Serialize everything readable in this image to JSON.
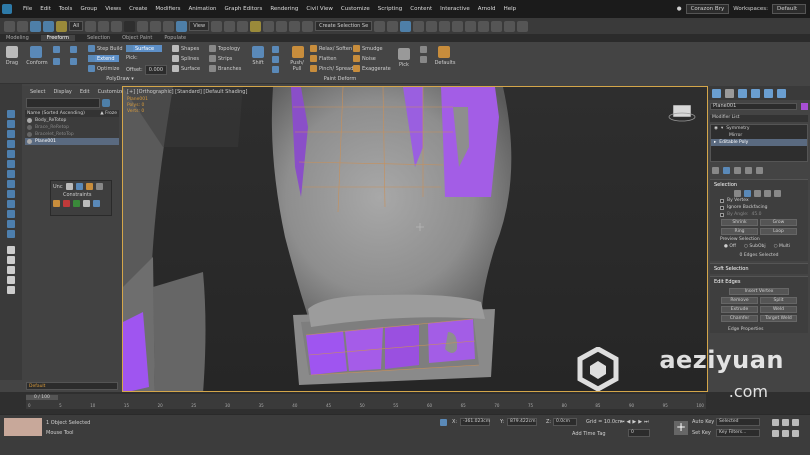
{
  "menubar": {
    "items": [
      "File",
      "Edit",
      "Tools",
      "Group",
      "Views",
      "Create",
      "Modifiers",
      "Animation",
      "Graph Editors",
      "Rendering",
      "Civil View",
      "Customize",
      "Scripting",
      "Content",
      "Interactive",
      "Arnold",
      "Help"
    ],
    "user": "Corazon Bry",
    "workspaces_label": "Workspaces:",
    "workspace_value": "Default"
  },
  "toolbar": {
    "selection_filter": "All",
    "reference_coord": "View",
    "named_selection": "Create Selection Se"
  },
  "ribbon": {
    "tabs": [
      "Modeling",
      "Freeform",
      "Selection",
      "Object Paint",
      "Populate"
    ],
    "active_tab": "Freeform",
    "drag": "Drag",
    "conform": "Conform",
    "step_build": "Step Build",
    "extend": "Extend",
    "optimize": "Optimize",
    "surface": "Surface",
    "pick_label": "Pick:",
    "offset_label": "Offset:",
    "offset_value": "0.000",
    "shapes": "Shapes",
    "splines": "Splines",
    "surface2": "Surface",
    "topology": "Topology",
    "strips": "Strips",
    "branches": "Branches",
    "shift": "Shift",
    "push_pull": "Push/ Pull",
    "relax_soften": "Relax/ Soften",
    "flatten": "Flatten",
    "pinch_spread": "Pinch/ Spread",
    "smudge": "Smudge",
    "noise": "Noise",
    "exaggerate": "Exaggerate",
    "pick": "Pick",
    "defaults": "Defaults",
    "polydraw": "PolyDraw ▾",
    "paint_deform": "Paint Deform"
  },
  "scene_explorer": {
    "menu": [
      "Select",
      "Display",
      "Edit",
      "Customize"
    ],
    "header": "Name (Sorted Ascending)",
    "frozen_header": "▲ Froze",
    "rows": [
      "Body_ReTotop",
      "Brace_ReRetop",
      "Bracelet_RetoTop",
      "Plane001"
    ],
    "selected": "Plane001"
  },
  "constraints": {
    "title": "Constraints",
    "label": "Unc"
  },
  "viewport": {
    "label": "[+] [Orthographic] [Standard] [Default Shading]",
    "stat_title": "Plane001",
    "stat_lines": [
      "Polys:  0",
      "Verts:  0"
    ]
  },
  "command_panel": {
    "name": "Plane001",
    "color": "#a84fd6",
    "modifier_list": "Modifier List",
    "stack": [
      "Symmetry",
      "Mirror",
      "Editable Poly"
    ],
    "stack_selected": "Editable Poly",
    "selection_title": "Selection",
    "by_vertex": "By Vertex",
    "ignore_backfacing": "Ignore Backfacing",
    "by_angle": "By Angle:",
    "by_angle_value": "45.0",
    "shrink": "Shrink",
    "grow": "Grow",
    "ring": "Ring",
    "loop": "Loop",
    "preview_selection": "Preview Selection",
    "off": "Off",
    "subobj": "SubObj",
    "multi": "Multi",
    "edges_selected": "0 Edges Selected",
    "soft_selection": "Soft Selection",
    "edit_edges": "Edit Edges",
    "insert_vertex": "Insert Vertex",
    "remove": "Remove",
    "split": "Split",
    "extrude": "Extrude",
    "weld": "Weld",
    "chamfer": "Chamfer",
    "target_weld": "Target Weld",
    "edge_properties": "Edge Properties"
  },
  "layer": {
    "value": "Default"
  },
  "timeline": {
    "frame": "0 / 100",
    "ticks": [
      "0",
      "5",
      "10",
      "15",
      "20",
      "25",
      "30",
      "35",
      "40",
      "45",
      "50",
      "55",
      "60",
      "65",
      "70",
      "75",
      "80",
      "85",
      "90",
      "95",
      "100"
    ]
  },
  "statusbar": {
    "selected": "1 Object Selected",
    "tool": "Mouse Tool",
    "x_label": "X:",
    "x_value": "-361.023cm",
    "y_label": "Y:",
    "y_value": "879.422cm",
    "z_label": "Z:",
    "z_value": "0.0cm",
    "grid": "Grid = 10.0cm",
    "add_time_tag": "Add Time Tag",
    "auto_key": "Auto Key",
    "selected_dd": "Selected",
    "set_key": "Set Key",
    "key_filters": "Key Filters...",
    "frame_value": "0"
  },
  "watermark": {
    "line1": "aeziyuan",
    "line2": ".com"
  }
}
